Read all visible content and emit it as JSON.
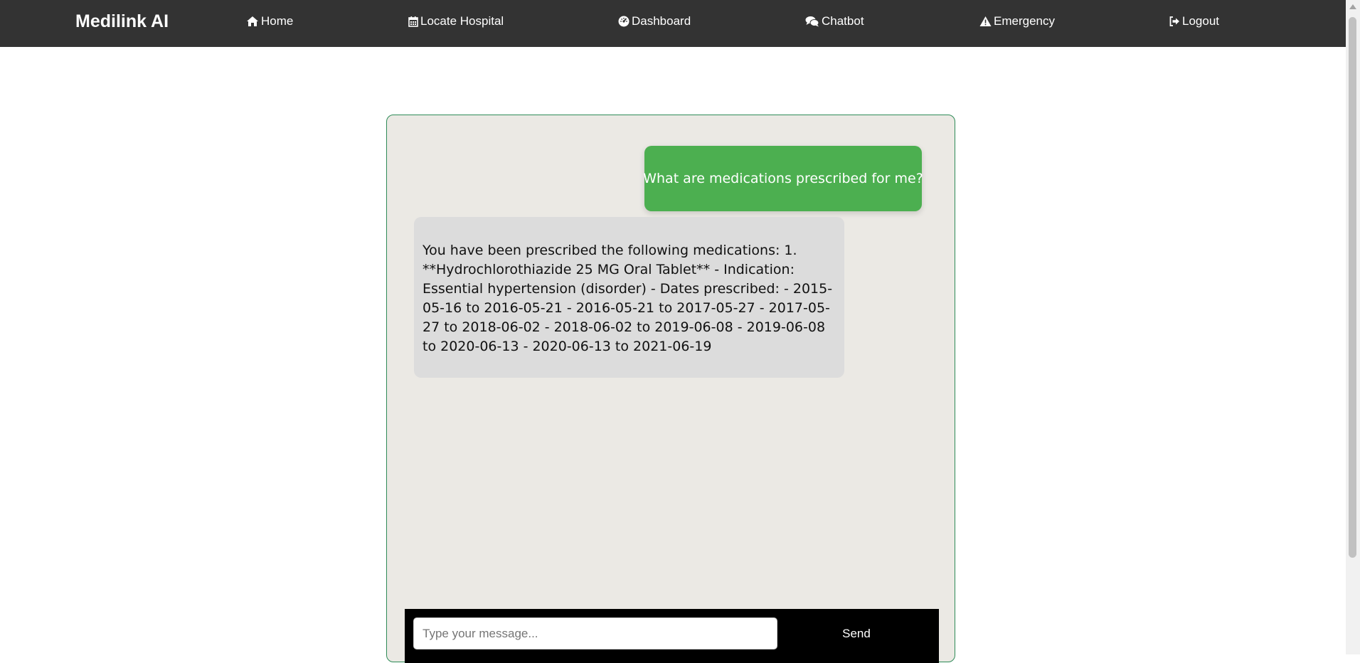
{
  "nav": {
    "brand": "Medilink AI",
    "items": [
      {
        "label": "Home",
        "icon": "home-icon"
      },
      {
        "label": "Locate Hospital",
        "icon": "calendar-icon"
      },
      {
        "label": "Dashboard",
        "icon": "dashboard-icon"
      },
      {
        "label": "Chatbot",
        "icon": "chat-icon"
      },
      {
        "label": "Emergency",
        "icon": "warning-icon"
      },
      {
        "label": "Logout",
        "icon": "logout-icon"
      }
    ]
  },
  "chat": {
    "messages": [
      {
        "role": "user",
        "text": "What are medications prescribed for me?"
      },
      {
        "role": "bot",
        "text": "You have been prescribed the following medications: 1. **Hydrochlorothiazide 25 MG Oral Tablet** - Indication: Essential hypertension (disorder) - Dates prescribed: - 2015-05-16 to 2016-05-21 - 2016-05-21 to 2017-05-27 - 2017-05-27 to 2018-06-02 - 2018-06-02 to 2019-06-08 - 2019-06-08 to 2020-06-13 - 2020-06-13 to 2021-06-19"
      }
    ],
    "input_placeholder": "Type your message...",
    "input_value": "",
    "send_label": "Send"
  },
  "colors": {
    "navbar": "#333333",
    "user_bubble": "#4caf50",
    "bot_bubble": "#dcdcdc",
    "chat_background": "#ebe9e4",
    "chat_border": "#2e8b57"
  }
}
